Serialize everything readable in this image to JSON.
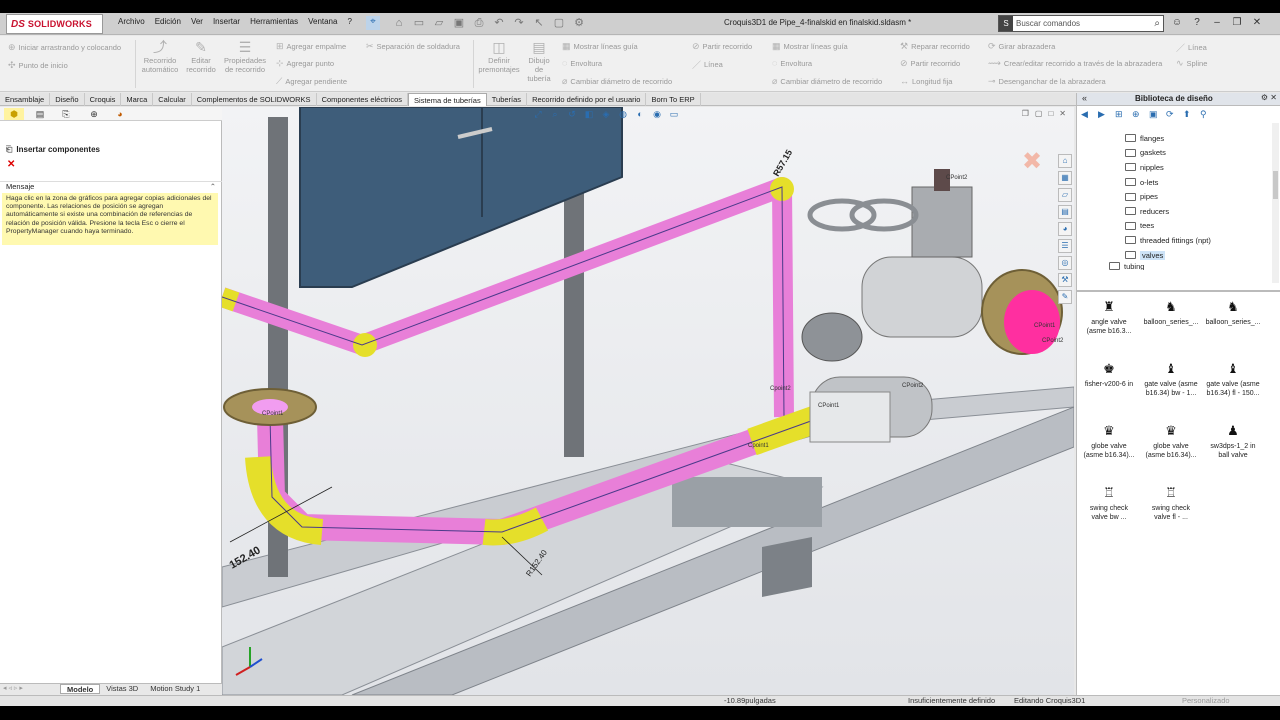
{
  "app": {
    "brand_prefix": "DS",
    "brand": "SOLIDWORKS",
    "document_title": "Croquis3D1 de Pipe_4-finalskid en finalskid.sldasm *",
    "menus": [
      "Archivo",
      "Edición",
      "Ver",
      "Insertar",
      "Herramientas",
      "Ventana",
      "?"
    ],
    "search_placeholder": "Buscar comandos"
  },
  "ribbon": {
    "drag_drop": "Iniciar arrastrando y colocando",
    "start_point": "Punto de inicio",
    "auto_route": [
      "Recorrido",
      "automático"
    ],
    "edit_route": [
      "Editar",
      "recorrido"
    ],
    "route_props": [
      "Propiedades",
      "de recorrido"
    ],
    "add_fitting": "Agregar empalme",
    "add_point": "Agregar punto",
    "add_slope": "Agregar pendiente",
    "weld_gap": "Separación de soldadura",
    "define_fittings": [
      "Definir",
      "premontajes"
    ],
    "pipe_drawing": [
      "Dibujo",
      "de",
      "tubería"
    ],
    "show_guides": "Mostrar líneas guía",
    "wrap": "Envoltura",
    "change_diam": "Cambiar diámetro de recorrido",
    "split_route": "Partir recorrido",
    "line": "Línea",
    "show_guides2": "Mostrar líneas guía",
    "wrap2": "Envoltura",
    "change_diam2": "Cambiar diámetro de recorrido",
    "repair_route": "Reparar recorrido",
    "split_route2": "Partir recorrido",
    "fixed_length": "Longitud fija",
    "rotate_clip": "Girar abrazadera",
    "create_edit_clip": "Crear/editar recorrido a través de la abrazadera",
    "unhook_clip": "Desenganchar de la abrazadera",
    "line2": "Línea",
    "spline": "Spline"
  },
  "tabs": [
    "Ensamblaje",
    "Diseño",
    "Croquis",
    "Marca",
    "Calcular",
    "Complementos de SOLIDWORKS",
    "Componentes eléctricos",
    "Sistema de tuberías",
    "Tuberías",
    "Recorrido definido por el usuario",
    "Born To ERP"
  ],
  "active_tab": "Sistema de tuberías",
  "property_manager": {
    "title": "Insertar componentes",
    "message_header": "Mensaje",
    "message": "Haga clic en la zona de gráficos para agregar copias adicionales del componente. Las relaciones de posición se agregan automáticamente si existe una combinación de referencias de relación de posición válida. Presione la tecla Esc o cierre el PropertyManager cuando haya terminado."
  },
  "bottom_tabs": [
    "Modelo",
    "Vistas 3D",
    "Motion Study 1"
  ],
  "design_library": {
    "title": "Biblioteca de diseño",
    "folders": [
      "flanges",
      "gaskets",
      "nipples",
      "o-lets",
      "pipes",
      "reducers",
      "tees",
      "threaded fittings (npt)",
      "valves",
      "tubing"
    ],
    "selected_folder": "valves",
    "components": [
      [
        "angle valve",
        "(asme b16.3..."
      ],
      [
        "balloon_series_..."
      ],
      [
        "balloon_series_..."
      ],
      [
        "fisher-v200-6 in"
      ],
      [
        "gate valve (asme",
        "b16.34) bw - 1..."
      ],
      [
        "gate valve (asme",
        "b16.34) fl - 150..."
      ],
      [
        "globe valve",
        "(asme b16.34)..."
      ],
      [
        "globe valve",
        "(asme b16.34)..."
      ],
      [
        "sw3dps-1_2 in",
        "ball valve"
      ],
      [
        "swing check",
        "valve  bw ..."
      ],
      [
        "swing check",
        "valve  fl - ..."
      ]
    ]
  },
  "viewport": {
    "dim_1": "R57.15",
    "dim_2": "152.40",
    "dim_3": "R152.40",
    "labels": [
      "CPoint1",
      "CPoint2",
      "Cpoint2",
      "Cpoint1",
      "CPoint1",
      "CPoint2",
      "CPoint1",
      "CPoint2"
    ]
  },
  "status": {
    "coord": "-10.89pulgadas",
    "defined": "Insuficientemente definido",
    "editing": "Editando Croquis3D1",
    "custom": "Personalizado"
  },
  "colors": {
    "pipe_magenta": "#e87fd8",
    "fitting_yellow": "#e5df2a",
    "brand_red": "#c8102e",
    "accent_blue": "#2a6db0"
  }
}
